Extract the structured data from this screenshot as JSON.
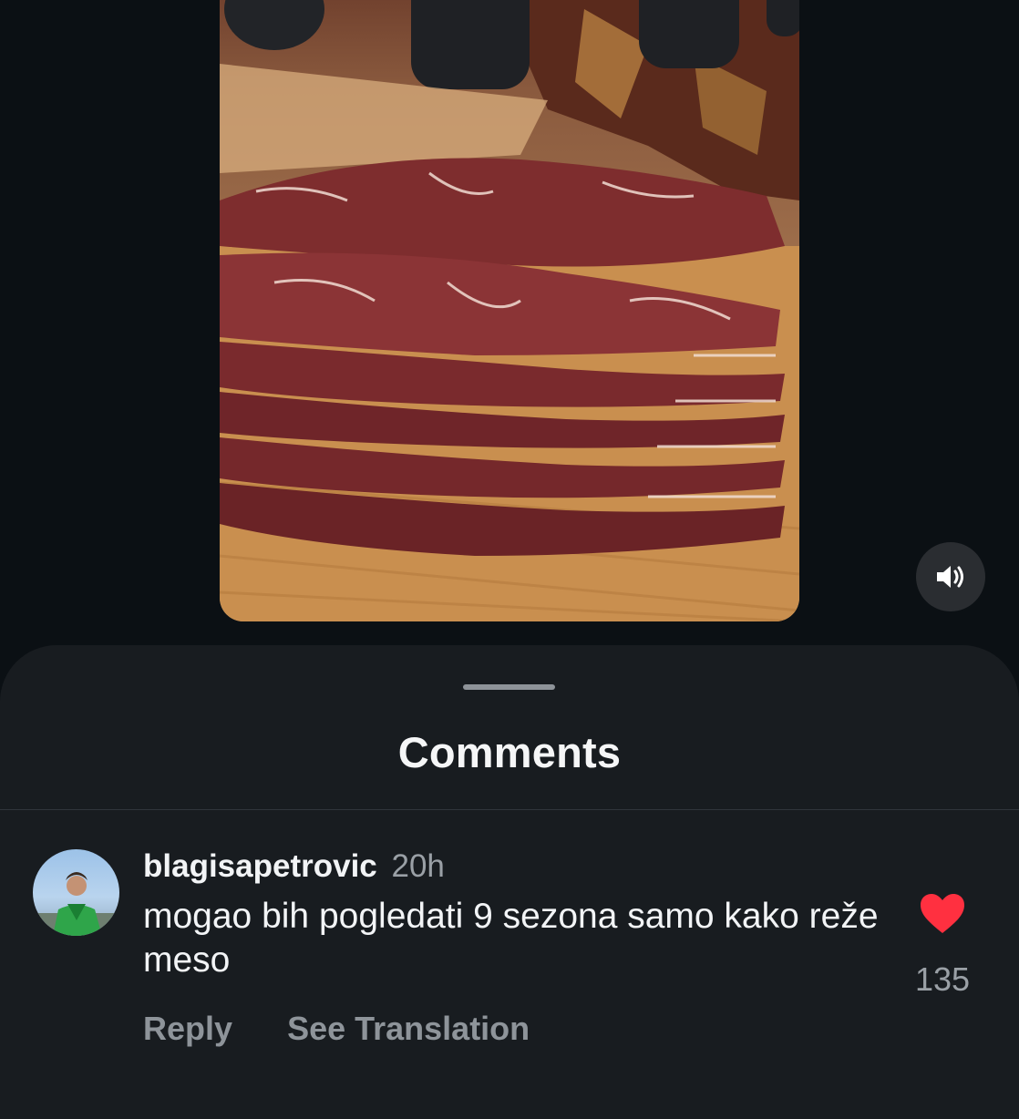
{
  "video": {
    "media_description_icon": "video-frame-meat-slices",
    "sound_icon": "speaker-icon"
  },
  "comments_sheet": {
    "title": "Comments",
    "comments": [
      {
        "username": "blagisapetrovic",
        "time": "20h",
        "text": "mogao bih pogledati 9 sezona samo kako reže meso",
        "like_count": "135",
        "liked": true,
        "reply_label": "Reply",
        "translate_label": "See Translation"
      }
    ]
  },
  "colors": {
    "background": "#0b1014",
    "sheet": "#181c20",
    "like_red": "#ff3040",
    "secondary_text": "#9aa0a6"
  }
}
